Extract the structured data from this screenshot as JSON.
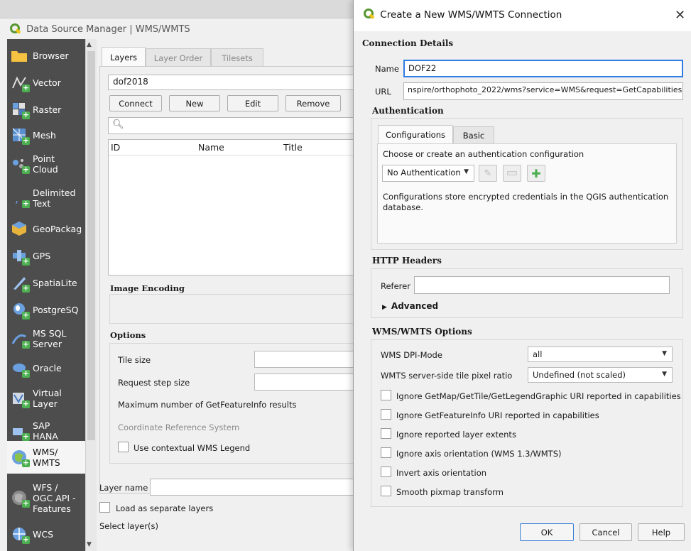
{
  "data_source_manager": {
    "title": "Data Source Manager | WMS/WMTS",
    "sidebar": {
      "items": [
        {
          "label": "Browser",
          "icon": "folder-icon"
        },
        {
          "label": "Vector",
          "icon": "vector-layer-icon"
        },
        {
          "label": "Raster",
          "icon": "raster-layer-icon"
        },
        {
          "label": "Mesh",
          "icon": "mesh-layer-icon"
        },
        {
          "label": "Point Cloud",
          "icon": "point-cloud-icon"
        },
        {
          "label": "Delimited Text",
          "icon": "delimited-text-icon"
        },
        {
          "label": "GeoPackag",
          "icon": "geopackage-icon"
        },
        {
          "label": "GPS",
          "icon": "gps-icon"
        },
        {
          "label": "SpatiaLite",
          "icon": "spatialite-icon"
        },
        {
          "label": "PostgreSQ",
          "icon": "postgresql-icon"
        },
        {
          "label": "MS SQL Server",
          "icon": "mssql-icon"
        },
        {
          "label": "Oracle",
          "icon": "oracle-icon"
        },
        {
          "label": "Virtual Layer",
          "icon": "virtual-layer-icon"
        },
        {
          "label": "SAP HANA",
          "icon": "sap-hana-icon"
        },
        {
          "label": "WMS/ WMTS",
          "icon": "wms-icon"
        },
        {
          "label": "WFS / OGC API - Features",
          "icon": "wfs-icon"
        },
        {
          "label": "WCS",
          "icon": "wcs-icon"
        }
      ],
      "selected": "WMS/ WMTS"
    },
    "tabs": [
      "Layers",
      "Layer Order",
      "Tilesets"
    ],
    "connection_combo": "dof2018",
    "buttons": {
      "connect": "Connect",
      "new": "New",
      "edit": "Edit",
      "remove": "Remove"
    },
    "search_placeholder": "",
    "table_headers": [
      "ID",
      "Name",
      "Title"
    ],
    "image_encoding_label": "Image Encoding",
    "options_label": "Options",
    "options": {
      "tile_size": "Tile size",
      "request_step_size": "Request step size",
      "max_getfeatureinfo": "Maximum number of GetFeatureInfo results",
      "crs": "Coordinate Reference System",
      "contextual_legend": "Use contextual WMS Legend"
    },
    "layer_name_label": "Layer name",
    "load_separate": "Load as separate layers",
    "select_layers": "Select layer(s)"
  },
  "dialog": {
    "title": "Create a New WMS/WMTS Connection",
    "close_glyph": "✕",
    "connection_details": "Connection Details",
    "name_label": "Name",
    "name_value": "DOF22",
    "url_label": "URL",
    "url_value": "nspire/orthophoto_2022/wms?service=WMS&request=GetCapabilities",
    "authentication": "Authentication",
    "auth_tabs": [
      "Configurations",
      "Basic"
    ],
    "auth_help": "Choose or create an authentication configuration",
    "auth_combo": "No Authentication",
    "auth_note": "Configurations store encrypted credentials in the QGIS authentication database.",
    "http_headers": "HTTP Headers",
    "referer_label": "Referer",
    "referer_value": "",
    "advanced_label": "Advanced",
    "wms_options": "WMS/WMTS Options",
    "dpi_mode_label": "WMS DPI-Mode",
    "dpi_mode_value": "all",
    "tile_ratio_label": "WMTS server-side tile pixel ratio",
    "tile_ratio_value": "Undefined (not scaled)",
    "checkboxes": [
      "Ignore GetMap/GetTile/GetLegendGraphic URI reported in capabilities",
      "Ignore GetFeatureInfo URI reported in capabilities",
      "Ignore reported layer extents",
      "Ignore axis orientation (WMS 1.3/WMTS)",
      "Invert axis orientation",
      "Smooth pixmap transform"
    ],
    "ok": "OK",
    "cancel": "Cancel",
    "help": "Help"
  },
  "colors": {
    "sidebar_bg": "#4d4d4d",
    "accent_focus": "#2f7de1",
    "qgis_green": "#589632",
    "qgis_yellow": "#f0c419"
  }
}
